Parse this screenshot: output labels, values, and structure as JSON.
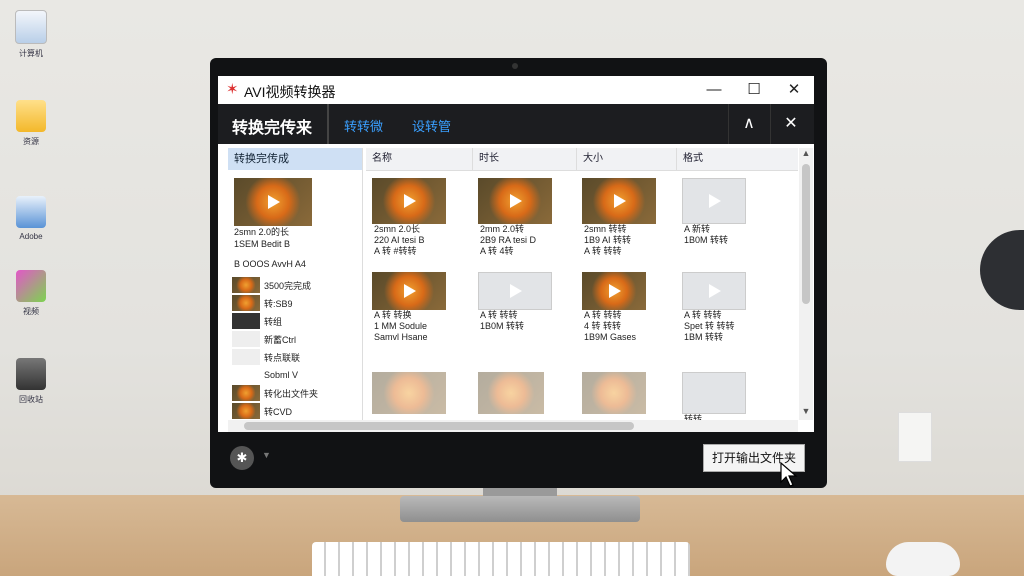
{
  "desktop": {
    "icons": [
      {
        "name": "file-icon",
        "label": "计算机"
      },
      {
        "name": "folder-icon",
        "label": "资源"
      },
      {
        "name": "tool-icon",
        "label": "Adobe"
      },
      {
        "name": "app-icon",
        "label": "视频"
      },
      {
        "name": "drive-icon",
        "label": "回收站"
      }
    ]
  },
  "window": {
    "title": "AVI视频转换器",
    "controls": {
      "minimize": "—",
      "maximize": "☐",
      "close": "✕"
    }
  },
  "header": {
    "title": "转换完传来",
    "tabs": [
      "转转微",
      "设转管"
    ],
    "collapse": "∧",
    "close": "✕"
  },
  "sidebar": {
    "header": "转换完传成",
    "main_item": {
      "l1": "2smn 2.0的长",
      "l2": "1SEM Bedit B"
    },
    "section_label": "B OOOS AvvH A4",
    "items": [
      {
        "label": "3500完完成"
      },
      {
        "label": "转:SB9"
      },
      {
        "label": "转组"
      },
      {
        "label": "新蓄Ctrl"
      },
      {
        "label": "转点联联"
      },
      {
        "label": "Sobml V"
      },
      {
        "label": "转化出文件夹"
      },
      {
        "label": "转CVD"
      }
    ]
  },
  "columns": [
    "名称",
    "时长",
    "大小",
    "格式"
  ],
  "files": [
    {
      "l1": "2smn 2.0长",
      "l2": "220 AI tesi B",
      "l3": "A 转 #转转"
    },
    {
      "l1": "2mm 2.0转",
      "l2": "2B9 RA tesi D",
      "l3": "A 转 4转"
    },
    {
      "l1": "2smn 转转",
      "l2": "1B9 AI 转转",
      "l3": "A 转 转转"
    },
    {
      "l1": "A 新转",
      "l2": "1B0M 转转",
      "l3": ""
    },
    {
      "l1": "A 转 转换",
      "l2": "1 MM Sodule",
      "l3": "Samvl Hsane"
    },
    {
      "l1": "A 转 转转",
      "l2": "1B0M 转转",
      "l3": ""
    },
    {
      "l1": "A 转 转转",
      "l2": "4 转 转转",
      "l3": "1B9M Gases"
    },
    {
      "l1": "A 转 转转",
      "l2": "Spet 转 转转",
      "l3": "1BM 转转"
    },
    {
      "l1": "",
      "l2": "",
      "l3": ""
    },
    {
      "l1": "",
      "l2": "",
      "l3": ""
    },
    {
      "l1": "",
      "l2": "",
      "l3": ""
    },
    {
      "l1": "转转",
      "l2": "",
      "l3": ""
    }
  ],
  "bottom": {
    "gear": "✱",
    "open_folder_label": "打开输出文件夹"
  },
  "colors": {
    "accent": "#3aa0ff",
    "header_bg": "#1c1d20",
    "selected_bg": "#cfe0f4"
  }
}
